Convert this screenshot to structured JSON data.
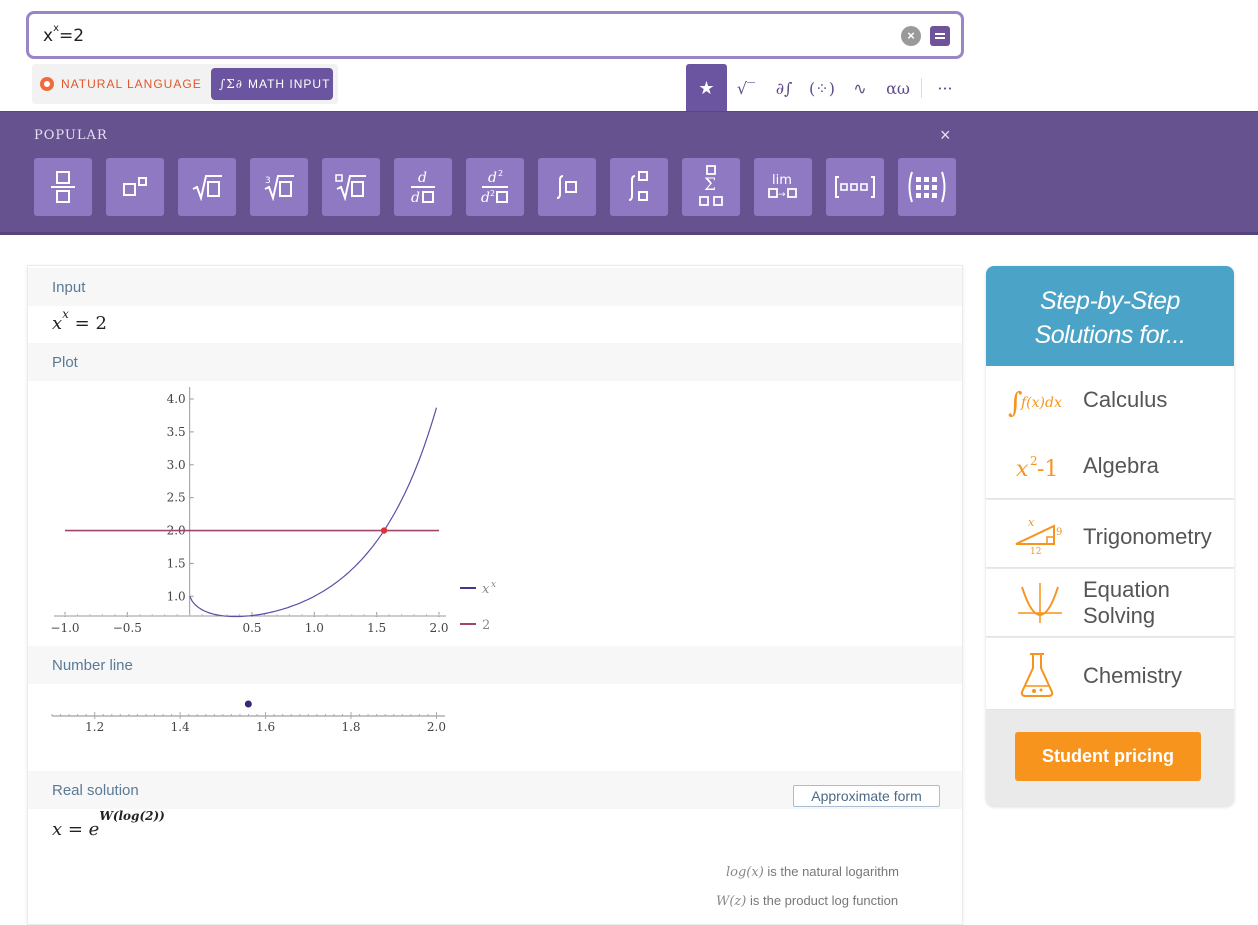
{
  "search": {
    "query_base": "x",
    "query_exp": "x",
    "query_rest": "=2"
  },
  "input_modes": {
    "natural": "NATURAL LANGUAGE",
    "math": "MATH INPUT"
  },
  "palette": {
    "tabs": [
      "favorites-star-icon",
      "sqrt-icon",
      "calculus-icon",
      "matrix-icon",
      "wave-icon",
      "greek-icon",
      "more-icon"
    ],
    "tab_glyphs": [
      "★",
      "√‾",
      "∂∫",
      "(⁘)",
      "∿",
      "αω",
      "···"
    ]
  },
  "popular": {
    "title": "POPULAR",
    "close": "×",
    "templates": [
      "fraction",
      "power",
      "square-root",
      "cube-root",
      "nth-root",
      "derivative",
      "second-derivative",
      "integral",
      "definite-integral",
      "sum",
      "limit",
      "vector",
      "matrix"
    ]
  },
  "pods": {
    "input": {
      "title": "Input",
      "expr_base": "x",
      "expr_exp": "x",
      "expr_rest": " = 2"
    },
    "plot": {
      "title": "Plot"
    },
    "numberline": {
      "title": "Number line"
    },
    "solution": {
      "title": "Real solution",
      "button": "Approximate form",
      "expr_lhs": "x = e",
      "expr_exp": "W(log(2))",
      "note1_func": "log(x)",
      "note1_text": " is the natural logarithm",
      "note2_func": "W(z)",
      "note2_text": " is the product log function"
    }
  },
  "chart_data": [
    {
      "type": "line",
      "title": "",
      "xlim": [
        -1.0,
        2.0
      ],
      "ylim": [
        0.7,
        4.0
      ],
      "xticks": [
        "−1.0",
        "−0.5",
        "0.5",
        "1.0",
        "1.5",
        "2.0"
      ],
      "yticks": [
        "1.0",
        "1.5",
        "2.0",
        "2.5",
        "3.0",
        "3.5",
        "4.0"
      ],
      "series": [
        {
          "name": "x^x",
          "color": "#5b4fa6",
          "function": "x^x",
          "x": [
            0.0,
            0.1,
            0.2,
            0.3,
            0.37,
            0.5,
            0.75,
            1.0,
            1.25,
            1.5,
            1.75,
            2.0
          ],
          "y": [
            1.0,
            0.79,
            0.72,
            0.7,
            0.69,
            0.71,
            0.81,
            1.0,
            1.32,
            1.84,
            2.66,
            4.0
          ]
        },
        {
          "name": "2",
          "color": "#a0466d",
          "function": "2",
          "x": [
            -1.0,
            2.0
          ],
          "y": [
            2.0,
            2.0
          ]
        }
      ],
      "points": [
        {
          "x": 1.5596,
          "y": 2.0,
          "color": "#e0303a"
        }
      ],
      "legend": [
        {
          "label": "x",
          "sup": "x",
          "color": "#3f3a8e"
        },
        {
          "label": "2",
          "sup": "",
          "color": "#a0466d"
        }
      ],
      "legend_position": "right"
    },
    {
      "type": "scatter",
      "title": "",
      "xlim": [
        1.1,
        2.02
      ],
      "xticks": [
        "1.2",
        "1.4",
        "1.6",
        "1.8",
        "2.0"
      ],
      "points": [
        {
          "x": 1.5596
        }
      ]
    }
  ],
  "sidebar": {
    "title_line1": "Step-by-Step",
    "title_line2": "Solutions for...",
    "items": [
      {
        "label": "Calculus",
        "icon": "integral-icon"
      },
      {
        "label": "Algebra",
        "icon": "algebra-icon"
      },
      {
        "label": "Trigonometry",
        "icon": "triangle-icon"
      },
      {
        "label": "Equation Solving",
        "label_line1": "Equation",
        "label_line2": "Solving",
        "icon": "graph-icon"
      },
      {
        "label": "Chemistry",
        "icon": "flask-icon"
      }
    ],
    "pricing_button": "Student pricing",
    "accent": "#4ba3c7",
    "orange": "#f7941d"
  }
}
